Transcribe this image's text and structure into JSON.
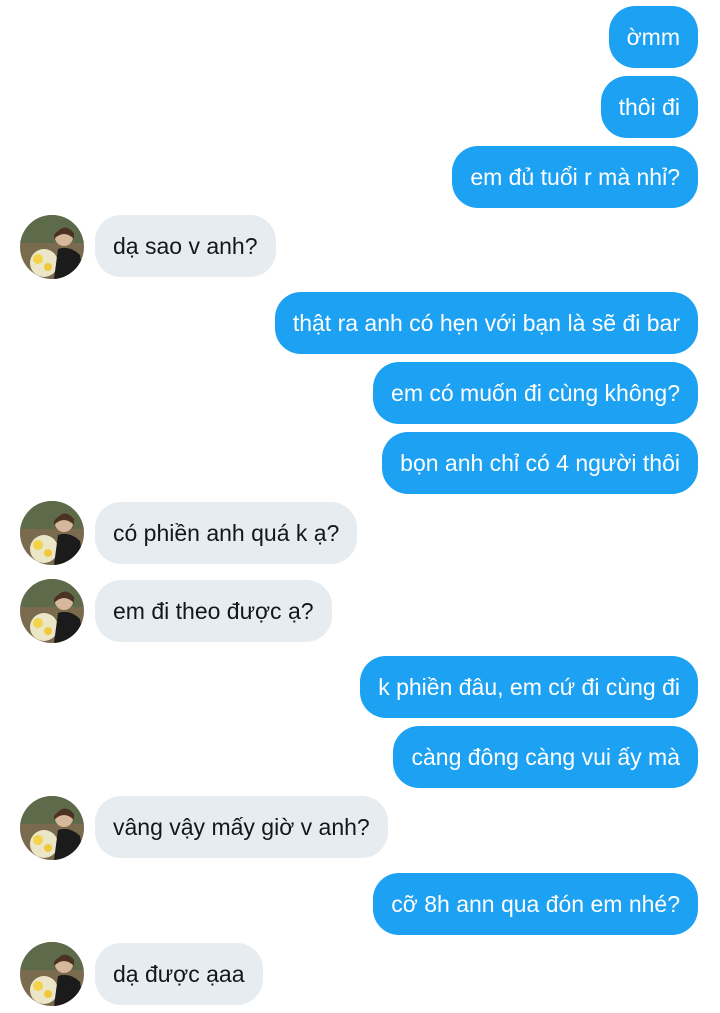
{
  "conversation": {
    "messages": [
      {
        "from": "me",
        "text": "ờmm"
      },
      {
        "from": "me",
        "text": "thôi đi"
      },
      {
        "from": "me",
        "text": "em đủ tuổi r mà nhỉ?"
      },
      {
        "from": "them",
        "text": "dạ sao v anh?"
      },
      {
        "from": "me",
        "text": "thật ra anh có hẹn với bạn là sẽ đi bar"
      },
      {
        "from": "me",
        "text": "em có muốn đi cùng không?"
      },
      {
        "from": "me",
        "text": "bọn anh chỉ có 4 người thôi"
      },
      {
        "from": "them",
        "text": "có phiền anh quá k ạ?"
      },
      {
        "from": "them",
        "text": "em đi theo được ạ?"
      },
      {
        "from": "me",
        "text": "k phiền đâu, em cứ đi cùng đi"
      },
      {
        "from": "me",
        "text": "càng đông càng vui ấy mà"
      },
      {
        "from": "them",
        "text": "vâng vậy mấy giờ v anh?"
      },
      {
        "from": "me",
        "text": "cỡ 8h ann qua đón em nhé?"
      },
      {
        "from": "them",
        "text": "dạ được ạaa"
      }
    ]
  },
  "colors": {
    "sent_bubble": "#1da1f2",
    "received_bubble": "#e6ecf0"
  },
  "icons": {
    "avatar": "contact-avatar"
  }
}
